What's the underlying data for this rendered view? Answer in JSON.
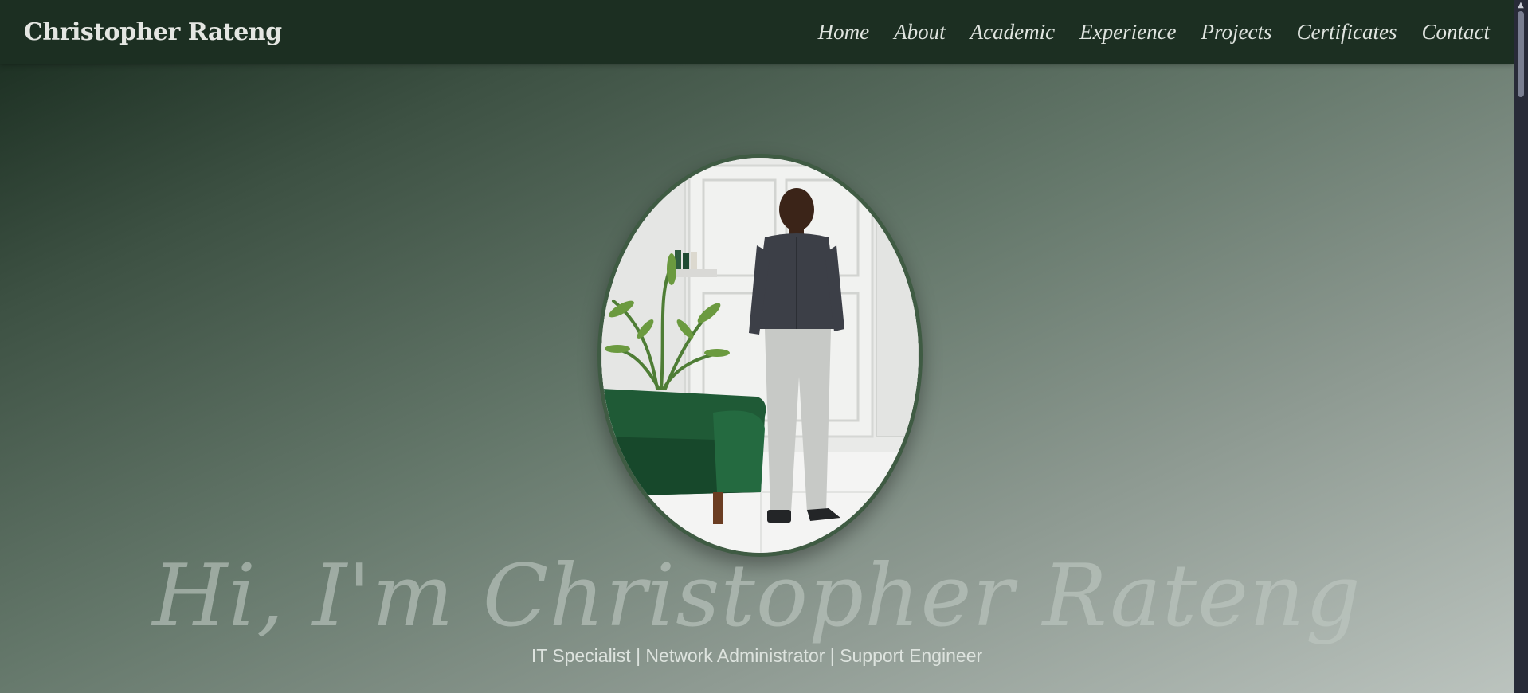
{
  "site": {
    "brand": "Christopher Rateng"
  },
  "nav": {
    "items": [
      {
        "label": "Home"
      },
      {
        "label": "About"
      },
      {
        "label": "Academic"
      },
      {
        "label": "Experience"
      },
      {
        "label": "Projects"
      },
      {
        "label": "Certificates"
      },
      {
        "label": "Contact"
      }
    ]
  },
  "hero": {
    "title": "Hi, I'm Christopher Rateng",
    "subtitle": "IT Specialist | Network Administrator | Support Engineer",
    "photo_alt": "profile-photo"
  },
  "colors": {
    "nav_bg": "#1c2f22",
    "frame": "#3f5b43",
    "text": "#dfe4df"
  },
  "icons": {
    "scroll_up": "chevron-up-icon"
  }
}
